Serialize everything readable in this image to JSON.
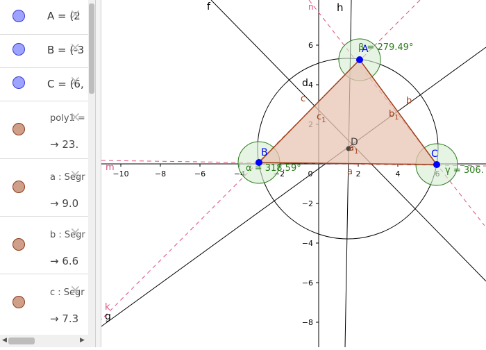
{
  "algebra": {
    "rows": [
      {
        "kind": "point",
        "color": "blue",
        "definition": "A = (2"
      },
      {
        "kind": "point",
        "color": "blue",
        "definition": "B = (-3"
      },
      {
        "kind": "point",
        "color": "blue",
        "definition": "C = (6,"
      },
      {
        "kind": "object",
        "color": "brown",
        "definition": "poly1 =",
        "value": "23."
      },
      {
        "kind": "object",
        "color": "brown",
        "definition": "a : Segr",
        "value": "9.0"
      },
      {
        "kind": "object",
        "color": "brown",
        "definition": "b : Segr",
        "value": "6.6"
      },
      {
        "kind": "object",
        "color": "brown",
        "definition": "c : Segr",
        "value": "7.3"
      }
    ],
    "arrow_glyph": "→",
    "delete_glyph": "×"
  },
  "graphics": {
    "x_ticks": [
      "−10",
      "−8",
      "−6",
      "−4",
      "−2",
      "0",
      "2",
      "4",
      "6"
    ],
    "y_ticks": [
      "6",
      "4",
      "2",
      "−2",
      "−4",
      "−6",
      "−8"
    ],
    "points": [
      {
        "name": "A",
        "x": 2.2,
        "y": 5.5
      },
      {
        "name": "B",
        "x": -4.5,
        "y": 0.5
      },
      {
        "name": "C",
        "x": 6.1,
        "y": 0.4
      },
      {
        "name": "D",
        "x": 1.8,
        "y": 1.2
      }
    ],
    "labels": {
      "f": "f",
      "h": "h",
      "g": "g",
      "k": "k",
      "m": "m",
      "d": "d",
      "c": "c",
      "b": "b",
      "a": "a",
      "c1": "c",
      "c1_sub": "1",
      "b1": "b",
      "b1_sub": "1",
      "a1": "a",
      "a1_sub": "1",
      "n": "n",
      "beta": "β = 279.49°",
      "alpha": "α = 318.59°",
      "gamma": "γ = 306."
    },
    "colors": {
      "triangle_fill": "#e8c4b4",
      "triangle_stroke": "#a0401a",
      "point": "#0000ff",
      "angle": "#2a7a1a",
      "dashed": "#e0507a",
      "line": "#000000"
    }
  }
}
